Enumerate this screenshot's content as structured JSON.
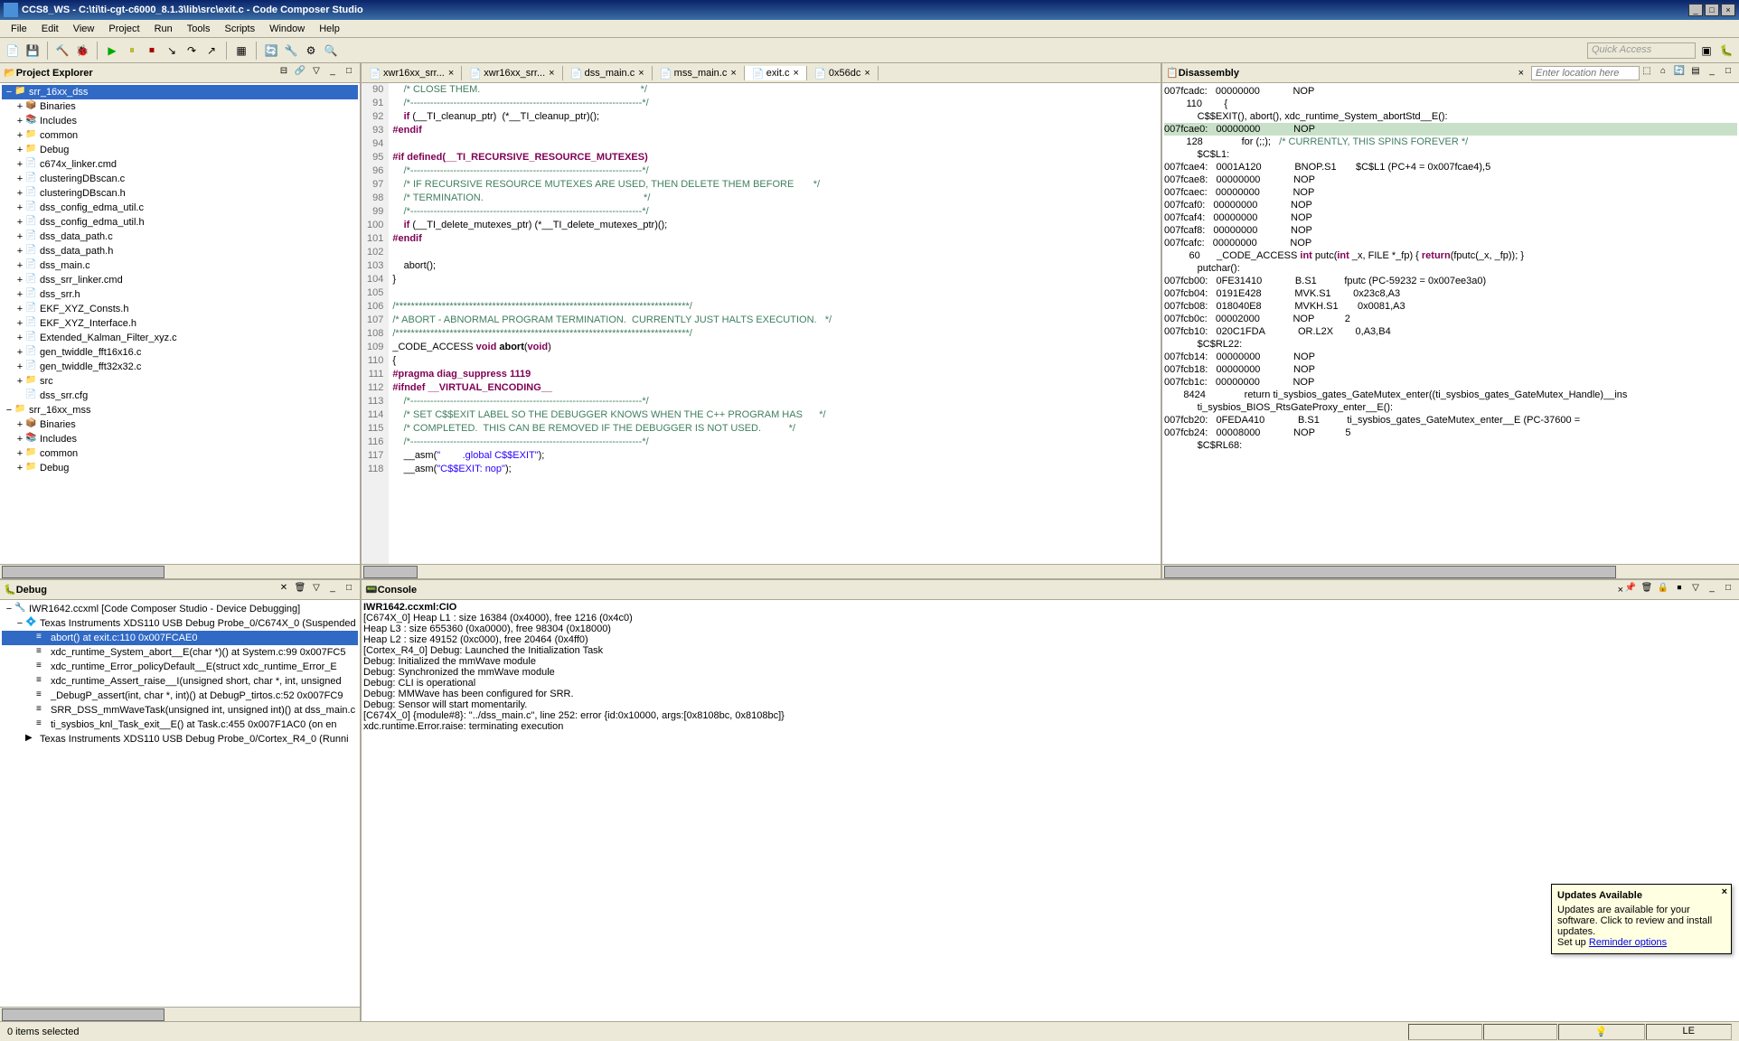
{
  "window": {
    "title": "CCS8_WS - C:\\ti\\ti-cgt-c6000_8.1.3\\lib\\src\\exit.c - Code Composer Studio",
    "min": "_",
    "max": "□",
    "close": "×"
  },
  "menu": {
    "items": [
      "File",
      "Edit",
      "View",
      "Project",
      "Run",
      "Tools",
      "Scripts",
      "Window",
      "Help"
    ]
  },
  "quick_access": "Quick Access",
  "project_explorer": {
    "title": "Project Explorer",
    "items": [
      {
        "indent": 0,
        "toggle": "−",
        "icon": "📁",
        "label": "srr_16xx_dss",
        "selected": true
      },
      {
        "indent": 1,
        "toggle": "+",
        "icon": "📦",
        "label": "Binaries"
      },
      {
        "indent": 1,
        "toggle": "+",
        "icon": "📚",
        "label": "Includes"
      },
      {
        "indent": 1,
        "toggle": "+",
        "icon": "📁",
        "label": "common"
      },
      {
        "indent": 1,
        "toggle": "+",
        "icon": "📁",
        "label": "Debug"
      },
      {
        "indent": 1,
        "toggle": "+",
        "icon": "📄",
        "label": "c674x_linker.cmd"
      },
      {
        "indent": 1,
        "toggle": "+",
        "icon": "📄",
        "label": "clusteringDBscan.c"
      },
      {
        "indent": 1,
        "toggle": "+",
        "icon": "📄",
        "label": "clusteringDBscan.h"
      },
      {
        "indent": 1,
        "toggle": "+",
        "icon": "📄",
        "label": "dss_config_edma_util.c"
      },
      {
        "indent": 1,
        "toggle": "+",
        "icon": "📄",
        "label": "dss_config_edma_util.h"
      },
      {
        "indent": 1,
        "toggle": "+",
        "icon": "📄",
        "label": "dss_data_path.c"
      },
      {
        "indent": 1,
        "toggle": "+",
        "icon": "📄",
        "label": "dss_data_path.h"
      },
      {
        "indent": 1,
        "toggle": "+",
        "icon": "📄",
        "label": "dss_main.c"
      },
      {
        "indent": 1,
        "toggle": "+",
        "icon": "📄",
        "label": "dss_srr_linker.cmd"
      },
      {
        "indent": 1,
        "toggle": "+",
        "icon": "📄",
        "label": "dss_srr.h"
      },
      {
        "indent": 1,
        "toggle": "+",
        "icon": "📄",
        "label": "EKF_XYZ_Consts.h"
      },
      {
        "indent": 1,
        "toggle": "+",
        "icon": "📄",
        "label": "EKF_XYZ_Interface.h"
      },
      {
        "indent": 1,
        "toggle": "+",
        "icon": "📄",
        "label": "Extended_Kalman_Filter_xyz.c"
      },
      {
        "indent": 1,
        "toggle": "+",
        "icon": "📄",
        "label": "gen_twiddle_fft16x16.c"
      },
      {
        "indent": 1,
        "toggle": "+",
        "icon": "📄",
        "label": "gen_twiddle_fft32x32.c"
      },
      {
        "indent": 1,
        "toggle": "+",
        "icon": "📁",
        "label": "src"
      },
      {
        "indent": 1,
        "toggle": "",
        "icon": "📄",
        "label": "dss_srr.cfg"
      },
      {
        "indent": 0,
        "toggle": "−",
        "icon": "📁",
        "label": "srr_16xx_mss"
      },
      {
        "indent": 1,
        "toggle": "+",
        "icon": "📦",
        "label": "Binaries"
      },
      {
        "indent": 1,
        "toggle": "+",
        "icon": "📚",
        "label": "Includes"
      },
      {
        "indent": 1,
        "toggle": "+",
        "icon": "📁",
        "label": "common"
      },
      {
        "indent": 1,
        "toggle": "+",
        "icon": "📁",
        "label": "Debug"
      }
    ]
  },
  "editor": {
    "tabs": [
      {
        "label": "xwr16xx_srr...",
        "active": false
      },
      {
        "label": "xwr16xx_srr...",
        "active": false
      },
      {
        "label": "dss_main.c",
        "active": false
      },
      {
        "label": "mss_main.c",
        "active": false
      },
      {
        "label": "exit.c",
        "active": true
      },
      {
        "label": "0x56dc",
        "active": false
      }
    ],
    "lines": [
      {
        "n": 90,
        "t": "    /* CLOSE THEM.                                                          */",
        "c": "comment"
      },
      {
        "n": 91,
        "t": "    /*----------------------------------------------------------------------*/",
        "c": "comment"
      },
      {
        "n": 92,
        "t": "    if (__TI_cleanup_ptr)  (*__TI_cleanup_ptr)();",
        "c": ""
      },
      {
        "n": 93,
        "t": "#endif",
        "c": "pp"
      },
      {
        "n": 94,
        "t": "",
        "c": ""
      },
      {
        "n": 95,
        "t": "#if defined(__TI_RECURSIVE_RESOURCE_MUTEXES)",
        "c": "pp"
      },
      {
        "n": 96,
        "t": "    /*----------------------------------------------------------------------*/",
        "c": "comment"
      },
      {
        "n": 97,
        "t": "    /* IF RECURSIVE RESOURCE MUTEXES ARE USED, THEN DELETE THEM BEFORE       */",
        "c": "comment"
      },
      {
        "n": 98,
        "t": "    /* TERMINATION.                                                          */",
        "c": "comment"
      },
      {
        "n": 99,
        "t": "    /*----------------------------------------------------------------------*/",
        "c": "comment"
      },
      {
        "n": 100,
        "t": "    if (__TI_delete_mutexes_ptr) (*__TI_delete_mutexes_ptr)();",
        "c": ""
      },
      {
        "n": 101,
        "t": "#endif",
        "c": "pp"
      },
      {
        "n": 102,
        "t": "",
        "c": ""
      },
      {
        "n": 103,
        "t": "    abort();",
        "c": ""
      },
      {
        "n": 104,
        "t": "}",
        "c": ""
      },
      {
        "n": 105,
        "t": "",
        "c": ""
      },
      {
        "n": 106,
        "t": "/****************************************************************************/",
        "c": "comment"
      },
      {
        "n": 107,
        "t": "/* ABORT - ABNORMAL PROGRAM TERMINATION.  CURRENTLY JUST HALTS EXECUTION.   */",
        "c": "comment"
      },
      {
        "n": 108,
        "t": "/****************************************************************************/",
        "c": "comment"
      },
      {
        "n": 109,
        "t": "_CODE_ACCESS void abort(void)",
        "c": ""
      },
      {
        "n": 110,
        "t": "{",
        "c": ""
      },
      {
        "n": 111,
        "t": "#pragma diag_suppress 1119",
        "c": "pp"
      },
      {
        "n": 112,
        "t": "#ifndef __VIRTUAL_ENCODING__",
        "c": "pp"
      },
      {
        "n": 113,
        "t": "    /*----------------------------------------------------------------------*/",
        "c": "comment"
      },
      {
        "n": 114,
        "t": "    /* SET C$$EXIT LABEL SO THE DEBUGGER KNOWS WHEN THE C++ PROGRAM HAS      */",
        "c": "comment"
      },
      {
        "n": 115,
        "t": "    /* COMPLETED.  THIS CAN BE REMOVED IF THE DEBUGGER IS NOT USED.          */",
        "c": "comment"
      },
      {
        "n": 116,
        "t": "    /*----------------------------------------------------------------------*/",
        "c": "comment"
      },
      {
        "n": 117,
        "t": "    __asm(\"        .global C$$EXIT\");",
        "c": ""
      },
      {
        "n": 118,
        "t": "    __asm(\"C$$EXIT: nop\");",
        "c": ""
      }
    ]
  },
  "disassembly": {
    "title": "Disassembly",
    "loc_placeholder": "Enter location here",
    "lines": [
      "007fcadc:   00000000            NOP",
      "        110        {",
      "            C$$EXIT(), abort(), xdc_runtime_System_abortStd__E():",
      "007fcae0:   00000000            NOP",
      "        128              for (;;);   /* CURRENTLY, THIS SPINS FOREVER */",
      "            $C$L1:",
      "007fcae4:   0001A120            BNOP.S1       $C$L1 (PC+4 = 0x007fcae4),5",
      "007fcae8:   00000000            NOP",
      "007fcaec:   00000000            NOP",
      "007fcaf0:   00000000            NOP",
      "007fcaf4:   00000000            NOP",
      "007fcaf8:   00000000            NOP",
      "007fcafc:   00000000            NOP",
      "         60      _CODE_ACCESS int putc(int _x, FILE *_fp) { return(fputc(_x, _fp)); }",
      "            putchar():",
      "007fcb00:   0FE31410            B.S1          fputc (PC-59232 = 0x007ee3a0)",
      "007fcb04:   0191E428            MVK.S1        0x23c8,A3",
      "007fcb08:   018040E8            MVKH.S1       0x0081,A3",
      "007fcb0c:   00002000            NOP           2",
      "007fcb10:   020C1FDA            OR.L2X        0,A3,B4",
      "            $C$RL22:",
      "007fcb14:   00000000            NOP",
      "007fcb18:   00000000            NOP",
      "007fcb1c:   00000000            NOP",
      "       8424              return ti_sysbios_gates_GateMutex_enter((ti_sysbios_gates_GateMutex_Handle)__ins",
      "            ti_sysbios_BIOS_RtsGateProxy_enter__E():",
      "007fcb20:   0FEDA410            B.S1          ti_sysbios_gates_GateMutex_enter__E (PC-37600 = ",
      "007fcb24:   00008000            NOP           5",
      "            $C$RL68:"
    ],
    "hl_index": 3
  },
  "debug": {
    "title": "Debug",
    "items": [
      {
        "indent": 0,
        "toggle": "−",
        "icon": "🔧",
        "label": "IWR1642.ccxml [Code Composer Studio - Device Debugging]"
      },
      {
        "indent": 1,
        "toggle": "−",
        "icon": "💠",
        "label": "Texas Instruments XDS110 USB Debug Probe_0/C674X_0 (Suspended"
      },
      {
        "indent": 2,
        "toggle": "",
        "icon": "≡",
        "label": "abort() at exit.c:110 0x007FCAE0",
        "selected": true
      },
      {
        "indent": 2,
        "toggle": "",
        "icon": "≡",
        "label": "xdc_runtime_System_abort__E(char *)() at System.c:99 0x007FC5"
      },
      {
        "indent": 2,
        "toggle": "",
        "icon": "≡",
        "label": "xdc_runtime_Error_policyDefault__E(struct xdc_runtime_Error_E"
      },
      {
        "indent": 2,
        "toggle": "",
        "icon": "≡",
        "label": "xdc_runtime_Assert_raise__I(unsigned short, char *, int, unsigned"
      },
      {
        "indent": 2,
        "toggle": "",
        "icon": "≡",
        "label": "_DebugP_assert(int, char *, int)() at DebugP_tirtos.c:52 0x007FC9"
      },
      {
        "indent": 2,
        "toggle": "",
        "icon": "≡",
        "label": "SRR_DSS_mmWaveTask(unsigned int, unsigned int)() at dss_main.c"
      },
      {
        "indent": 2,
        "toggle": "",
        "icon": "≡",
        "label": "ti_sysbios_knl_Task_exit__E() at Task.c:455 0x007F1AC0  (on en"
      },
      {
        "indent": 1,
        "toggle": "",
        "icon": "▶",
        "label": "Texas Instruments XDS110 USB Debug Probe_0/Cortex_R4_0 (Runni"
      }
    ]
  },
  "console": {
    "title": "Console",
    "header": "IWR1642.ccxml:CIO",
    "lines": [
      "[C674X_0] Heap L1 : size 16384 (0x4000), free 1216 (0x4c0)",
      "Heap L3 : size 655360 (0xa0000), free 98304 (0x18000)",
      "Heap L2 : size 49152 (0xc000), free 20464 (0x4ff0)",
      "[Cortex_R4_0] Debug: Launched the Initialization Task",
      "Debug: Initialized the mmWave module",
      "Debug: Synchronized the mmWave module",
      "Debug: CLI is operational",
      "Debug: MMWave has been configured for SRR.",
      "Debug: Sensor will start momentarily.",
      "[C674X_0] {module#8}: \"../dss_main.c\", line 252: error {id:0x10000, args:[0x8108bc, 0x8108bc]}",
      "xdc.runtime.Error.raise: terminating execution"
    ]
  },
  "status": {
    "text": "0 items selected",
    "le": "LE"
  },
  "notification": {
    "title": "Updates Available",
    "body": "Updates are available for your software. Click to review and install updates.",
    "setup": "Set up",
    "link": "Reminder options"
  }
}
